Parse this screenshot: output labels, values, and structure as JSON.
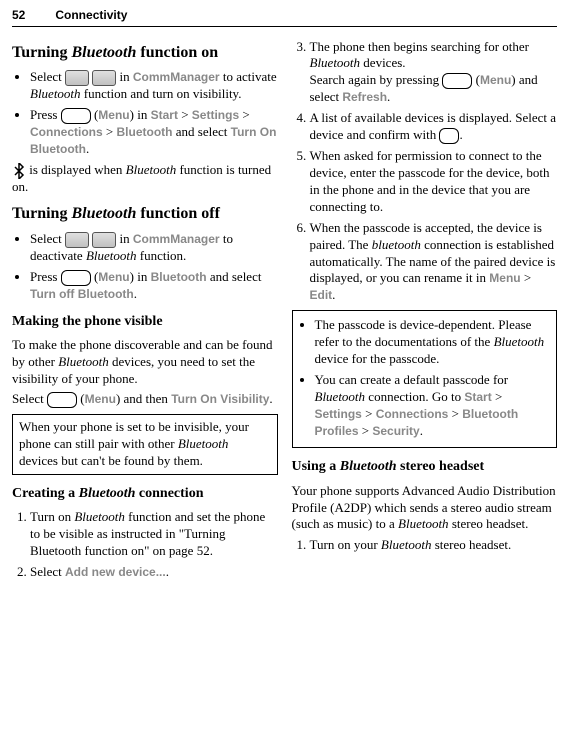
{
  "header": {
    "page": "52",
    "section": "Connectivity"
  },
  "left": {
    "h1": "Turning Bluetooth function on",
    "bullet1_pre": "Select ",
    "bullet1_mid": " in ",
    "bullet1_comm": "CommManager",
    "bullet1_post": " to activate Bluetooth function and turn on visibility.",
    "bullet2_pre": "Press ",
    "bullet2_menu": "Menu",
    "bullet2_in": ") in ",
    "bullet2_start": "Start",
    "bullet2_gt1": " > ",
    "bullet2_settings": "Settings",
    "bullet2_gt2": " > ",
    "bullet2_conn": "Connections",
    "bullet2_gt3": " > ",
    "bullet2_bt": "Bluetooth",
    "bullet2_sel": " and select ",
    "bullet2_turn": "Turn On Bluetooth",
    "bullet2_dot": ".",
    "para1_post": " is displayed when Bluetooth function is turned on.",
    "h2": "Turning Bluetooth function off",
    "bullet3_pre": "Select ",
    "bullet3_mid": " in ",
    "bullet3_comm": "CommManager",
    "bullet3_post": " to deactivate Bluetooth function.",
    "bullet4_pre": "Press ",
    "bullet4_menu": "Menu",
    "bullet4_in": ") in ",
    "bullet4_bt": "Bluetooth",
    "bullet4_sel": " and select ",
    "bullet4_turn": "Turn off Bluetooth",
    "bullet4_dot": ".",
    "h3": "Making the phone visible",
    "para2": "To make the phone discoverable and can be found by other Bluetooth devices, you need to set the visibility of your phone.",
    "para3_pre": "Select ",
    "para3_menu": "Menu",
    "para3_mid": ") and then ",
    "para3_turn": "Turn On Visibility",
    "para3_dot": ".",
    "note1": "When your phone is set to be invisible, your phone can still pair with other Bluetooth devices but can't be found by them.",
    "h4": "Creating a Bluetooth connection",
    "ol1": "Turn on Bluetooth function and set the phone to be visible as instructed in \"Turning Bluetooth function on\" on page 52.",
    "ol2_pre": "Select ",
    "ol2_add": "Add new device...",
    "ol2_dot": "."
  },
  "right": {
    "ol3_a": "The phone then begins searching for other Bluetooth devices.",
    "ol3_b_pre": "Search again by pressing ",
    "ol3_b_menu": "Menu",
    "ol3_b_mid": ") and select ",
    "ol3_b_refresh": "Refresh",
    "ol3_b_dot": ".",
    "ol4_a": "A list of available devices is displayed. Select a device and confirm with ",
    "ol4_dot": ".",
    "ol5": "When asked for permission to connect to the device, enter the passcode for the device, both in the phone and in the device that you are connecting to.",
    "ol6_a": "When the passcode is accepted, the device is paired. The bluetooth connection is established automatically. The name of the paired device is displayed, or you can rename it in ",
    "ol6_menu": "Menu",
    "ol6_gt": " > ",
    "ol6_edit": "Edit",
    "ol6_dot": ".",
    "note2_b1": "The passcode is device-dependent. Please refer to the documentations of the Bluetooth device for the passcode.",
    "note2_b2_pre": "You can create a default passcode for Bluetooth connection. Go to ",
    "note2_start": "Start",
    "note2_gt1": " > ",
    "note2_settings": "Settings",
    "note2_gt2": " > ",
    "note2_conn": "Connections",
    "note2_gt3": " > ",
    "note2_btprof": "Bluetooth Profiles",
    "note2_gt4": " > ",
    "note2_sec": "Security",
    "note2_dot": ".",
    "h5": "Using a Bluetooth stereo headset",
    "para4": "Your phone supports Advanced Audio Distribution Profile (A2DP) which sends a stereo audio stream (such as music) to a Bluetooth stereo headset.",
    "ol1b": "Turn on your Bluetooth stereo headset."
  }
}
